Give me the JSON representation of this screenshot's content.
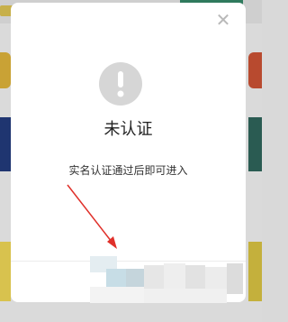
{
  "dialog": {
    "title": "未认证",
    "message": "实名认证通过后即可进入",
    "close_glyph": "✕",
    "icon": "exclamation-circle-icon",
    "footer_button_state": "obscured"
  },
  "colors": {
    "overlay": "#dadada",
    "dialog_bg": "#ffffff",
    "icon_circle": "#d6d6d6",
    "arrow": "#e0302a",
    "close_icon": "#b9b9b9"
  }
}
